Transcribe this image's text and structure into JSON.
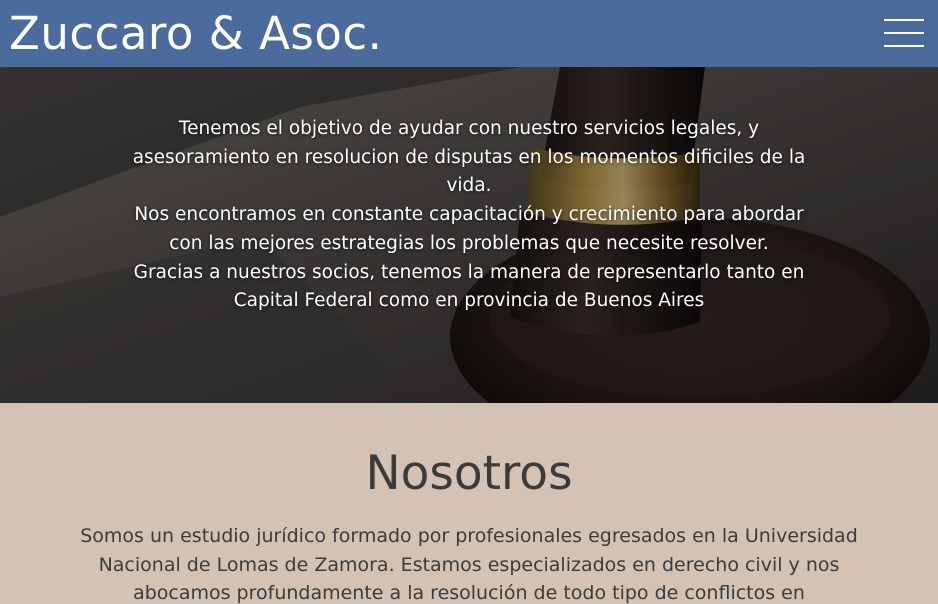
{
  "navbar": {
    "brand": "Zuccaro & Asoc.",
    "menu_icon": "hamburger-menu-icon",
    "background_color": "#4a6b9c"
  },
  "hero": {
    "background_image": "gavel-photo",
    "paragraphs": [
      "Tenemos el objetivo de ayudar con nuestro servicios legales, y asesoramiento en resolucion de disputas en los momentos dificiles de la vida.",
      "Nos encontramos en constante capacitación y crecimiento para abordar con las mejores estrategias los problemas que necesite resolver.",
      "Gracias a nuestros socios, tenemos la manera de representarlo tanto en Capital Federal como en provincia de Buenos Aires"
    ]
  },
  "about": {
    "title": "Nosotros",
    "text": "Somos un estudio jurídico formado por profesionales egresados en la Universidad Nacional de Lomas de Zamora. Estamos especializados en derecho civil y nos abocamos profundamente a la resolución de todo tipo de conflictos en",
    "background_color": "#d4c2b4"
  }
}
